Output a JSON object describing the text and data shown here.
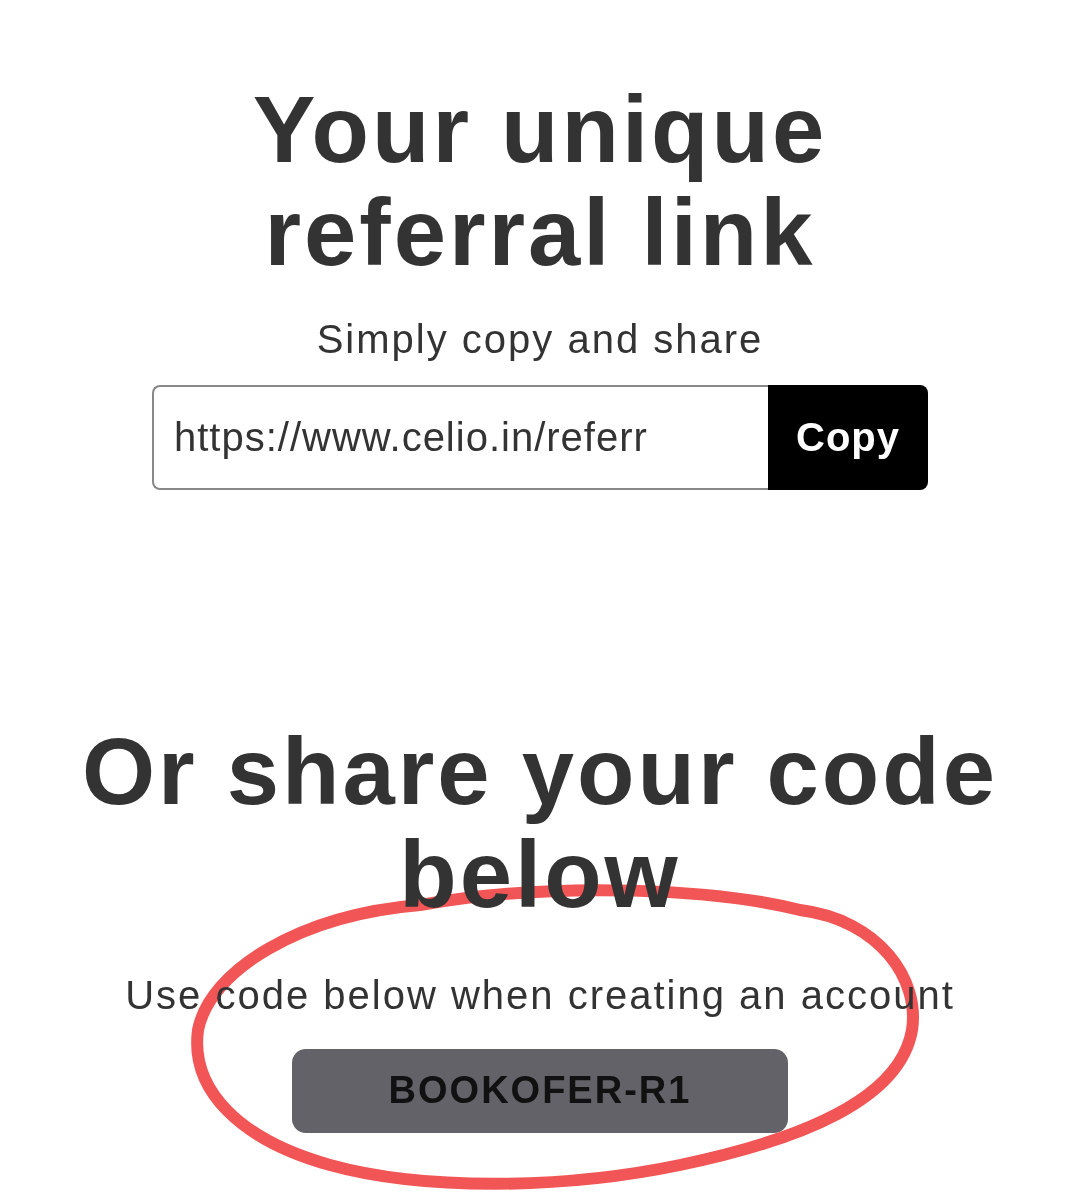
{
  "link_section": {
    "title": "Your unique referral link",
    "subtitle": "Simply copy and share",
    "link_field": {
      "value": "https://www.celio.in/referr"
    },
    "copy_button": "Copy"
  },
  "code_section": {
    "title": "Or share your code below",
    "subtitle": "Use code below when creating an account",
    "code": "BOOKOFER-R1"
  }
}
